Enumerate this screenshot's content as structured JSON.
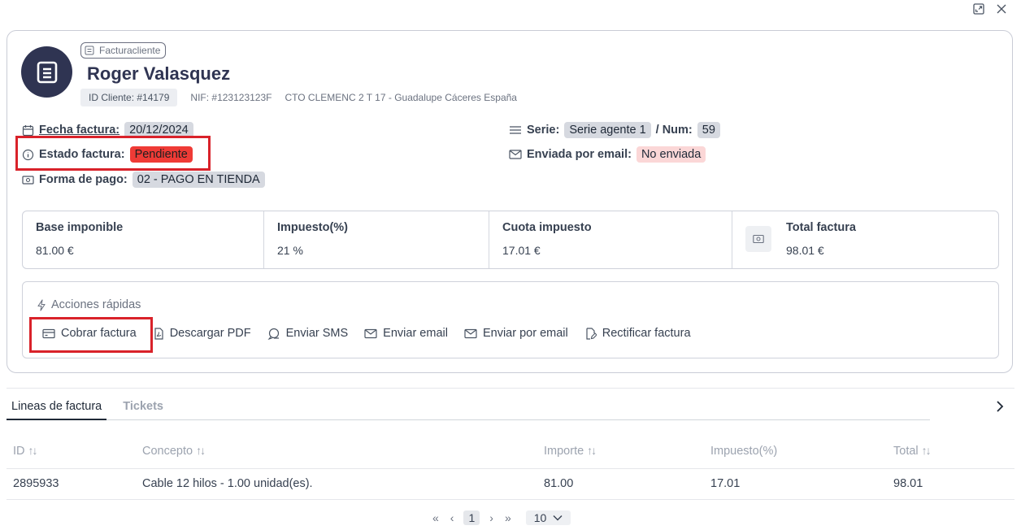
{
  "header": {
    "doc_type": "Facturacliente",
    "client_name": "Roger Valasquez",
    "client_id": "ID Cliente: #14179",
    "nif": "NIF: #123123123F",
    "address": "CTO CLEMENC 2 T 17 - Guadalupe Cáceres España"
  },
  "fields": {
    "fecha_label": "Fecha factura:",
    "fecha_value": "20/12/2024",
    "estado_label": "Estado factura:",
    "estado_value": "Pendiente",
    "forma_pago_label": "Forma de pago:",
    "forma_pago_value": "02 - PAGO EN TIENDA",
    "serie_label": "Serie:",
    "serie_value": "Serie agente 1",
    "num_label": "/ Num:",
    "num_value": "59",
    "email_label": "Enviada por email:",
    "email_value": "No enviada"
  },
  "totals": [
    {
      "label": "Base imponible",
      "value": "81.00 €"
    },
    {
      "label": "Impuesto(%)",
      "value": "21 %"
    },
    {
      "label": "Cuota impuesto",
      "value": "17.01 €"
    },
    {
      "label": "Total factura",
      "value": "98.01 €"
    }
  ],
  "quick_actions": {
    "title": "Acciones rápidas",
    "items": [
      {
        "label": "Cobrar factura",
        "icon": "credit-card-icon"
      },
      {
        "label": "Descargar PDF",
        "icon": "pdf-icon"
      },
      {
        "label": "Enviar SMS",
        "icon": "sms-icon"
      },
      {
        "label": "Enviar email",
        "icon": "mail-icon"
      },
      {
        "label": "Enviar por email",
        "icon": "mail-icon"
      },
      {
        "label": "Rectificar factura",
        "icon": "edit-icon"
      }
    ]
  },
  "tabs": [
    "Lineas de factura",
    "Tickets"
  ],
  "table": {
    "columns": [
      "ID",
      "Concepto",
      "Importe",
      "Impuesto(%)",
      "Total"
    ],
    "sortable": [
      true,
      true,
      true,
      false,
      true
    ],
    "rows": [
      [
        "2895933",
        "Cable 12 hilos - 1.00 unidad(es).",
        "81.00",
        "17.01",
        "98.01"
      ]
    ]
  },
  "pager": {
    "first": "«",
    "prev": "‹",
    "current": "1",
    "next": "›",
    "last": "»",
    "page_size": "10"
  },
  "colors": {
    "accent": "#2f3452",
    "status_pending": "#ef3b36",
    "highlight": "#d9222a"
  }
}
